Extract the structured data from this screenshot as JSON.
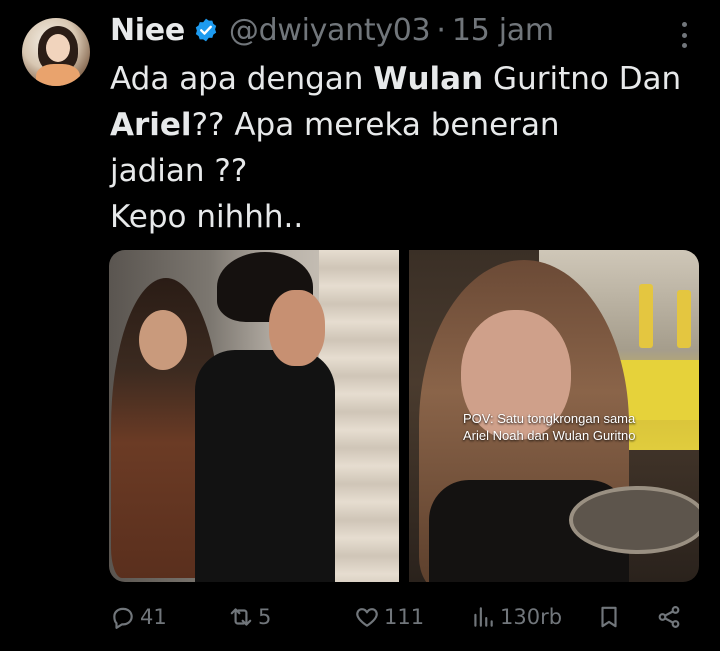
{
  "tweet": {
    "author_name": "Niee",
    "handle": "@dwiyanty03",
    "separator": "·",
    "time": "15 jam",
    "text_lines": [
      {
        "a": "Ada apa dengan ",
        "b": "Wulan",
        "c": " Guritno Dan"
      },
      {
        "a": "",
        "b": "Ariel",
        "c": "?? Apa mereka beneran"
      },
      {
        "a": "jadian ??",
        "b": "",
        "c": ""
      },
      {
        "a": "Kepo nihhh..",
        "b": "",
        "c": ""
      }
    ],
    "media_caption_line1": "POV: Satu tongkrongan sama",
    "media_caption_line2": "Ariel Noah dan Wulan Guritno"
  },
  "actions": {
    "replies": "41",
    "reposts": "5",
    "likes": "111",
    "views": "130rb"
  },
  "icons": {
    "verified": "verified-badge-icon",
    "more": "more-dots-icon",
    "reply": "reply-icon",
    "repost": "repost-icon",
    "like": "heart-icon",
    "views": "views-icon",
    "bookmark": "bookmark-icon",
    "share": "share-icon"
  },
  "colors": {
    "background": "#000000",
    "text": "#e7e9ea",
    "muted": "#71767b",
    "verified": "#1d9bf0"
  }
}
